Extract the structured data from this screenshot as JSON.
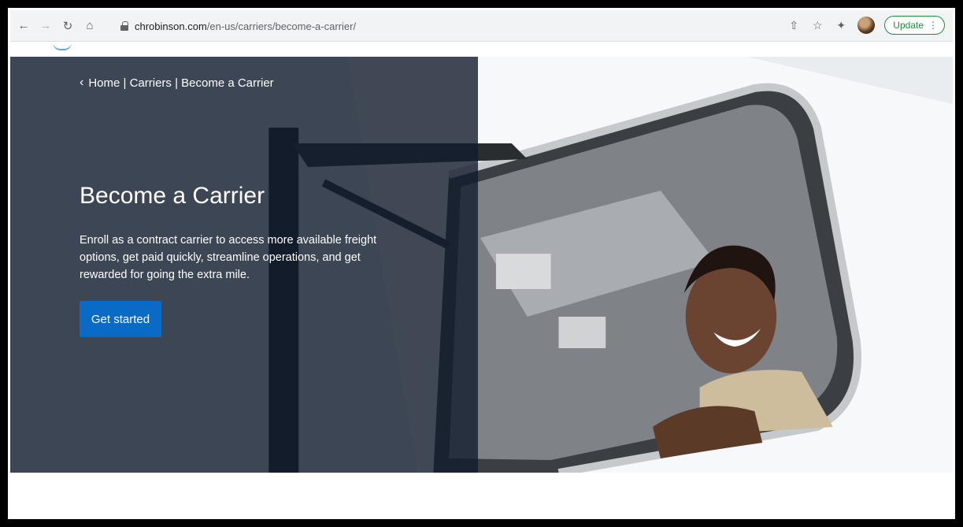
{
  "browser": {
    "url_host": "chrobinson.com",
    "url_path": "/en-us/carriers/become-a-carrier/",
    "update_label": "Update"
  },
  "hero": {
    "breadcrumb": "Home | Carriers | Become a Carrier",
    "title": "Become a Carrier",
    "description": "Enroll as a contract carrier to access more available freight options, get paid quickly, streamline operations, and get rewarded for going the extra mile.",
    "cta_label": "Get started"
  },
  "icons": {
    "back": "back-arrow-icon",
    "forward": "forward-arrow-icon",
    "reload": "reload-icon",
    "home": "home-icon",
    "lock": "lock-icon",
    "share": "share-icon",
    "star": "bookmark-star-icon",
    "extensions": "puzzle-icon",
    "menu": "kebab-menu-icon"
  },
  "colors": {
    "cta": "#0a6bc6",
    "overlay": "#111c2d",
    "update": "#1e8e3e"
  }
}
